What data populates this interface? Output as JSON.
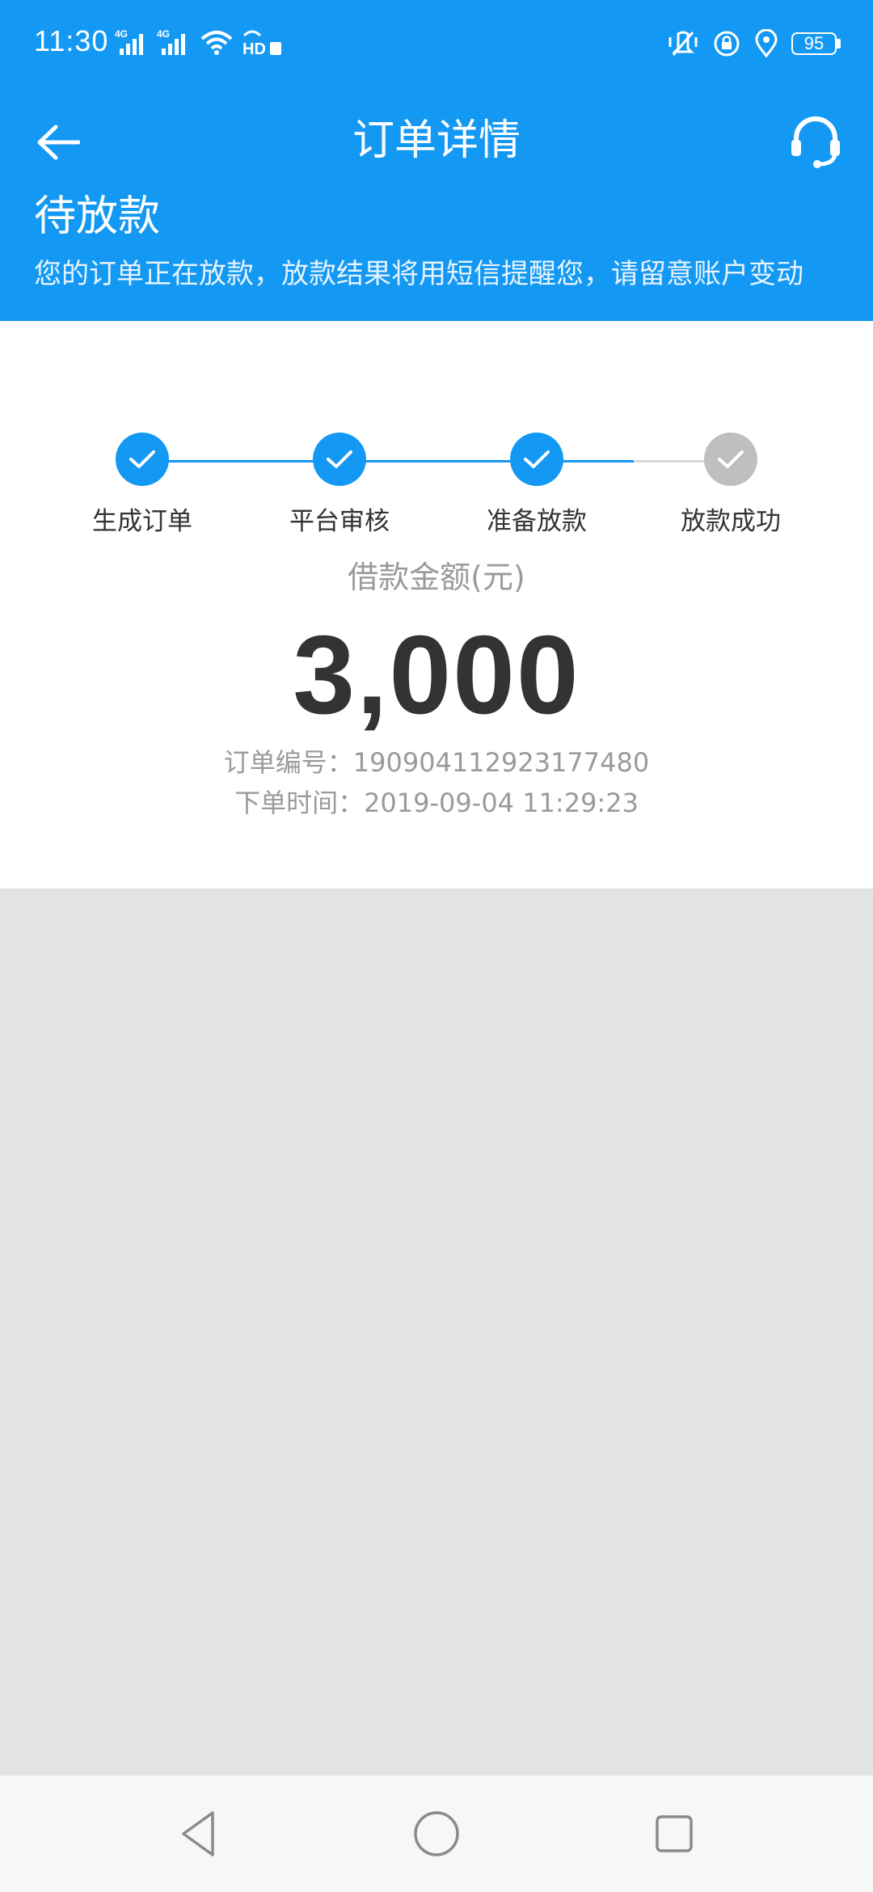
{
  "status_bar": {
    "time": "11:30",
    "signal_1_label": "4G",
    "signal_2_label": "4G",
    "hd_label": "HD",
    "battery": "95"
  },
  "header": {
    "title": "订单详情",
    "order_status": "待放款",
    "status_description": "您的订单正在放款，放款结果将用短信提醒您，请留意账户变动"
  },
  "progress": {
    "steps": [
      {
        "label": "生成订单",
        "done": true
      },
      {
        "label": "平台审核",
        "done": true
      },
      {
        "label": "准备放款",
        "done": true
      },
      {
        "label": "放款成功",
        "done": false
      }
    ],
    "active_color": "#1399f3",
    "inactive_color": "#bfbfbf"
  },
  "loan": {
    "amount_label": "借款金额(元)",
    "amount": "3,000",
    "order_number": "订单编号：190904112923177480",
    "order_time": "下单时间：2019-09-04 11:29:23"
  },
  "icons": {
    "back": "back-arrow-icon",
    "service": "headset-icon",
    "check": "check-icon",
    "nav_back": "triangle-back-icon",
    "nav_home": "circle-home-icon",
    "nav_recent": "square-recent-icon"
  },
  "colors": {
    "primary": "#1399f3",
    "text_dark": "#333333",
    "text_gray": "#9a9a9a",
    "background": "#e3e3e3"
  }
}
